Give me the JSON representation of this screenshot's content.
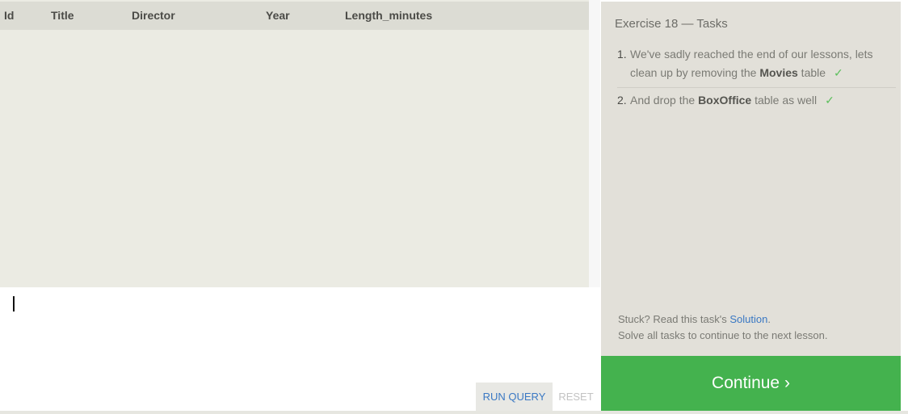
{
  "results_table": {
    "columns": [
      "Id",
      "Title",
      "Director",
      "Year",
      "Length_minutes"
    ],
    "rows": []
  },
  "editor": {
    "query_text": "",
    "run_label": "RUN QUERY",
    "reset_label": "RESET"
  },
  "tasks_panel": {
    "title": "Exercise 18 — Tasks",
    "tasks": [
      {
        "number": "1.",
        "text_before": "We've sadly reached the end of our lessons, lets clean up by removing the ",
        "bold": "Movies",
        "text_after": " table",
        "check": "✓",
        "completed": true
      },
      {
        "number": "2.",
        "text_before": "And drop the ",
        "bold": "BoxOffice",
        "text_after": " table as well",
        "check": "✓",
        "completed": true
      }
    ],
    "stuck_text": "Stuck? Read this task's ",
    "solution_link": "Solution",
    "stuck_period": ".",
    "solve_all_text": "Solve all tasks to continue to the next lesson."
  },
  "continue_label": "Continue ›",
  "colors": {
    "continue_bg": "#44b24e",
    "link": "#3a78c3",
    "check": "#5cbf5c",
    "panel_bg": "#e2e0d9",
    "results_bg": "#ebebe3"
  }
}
